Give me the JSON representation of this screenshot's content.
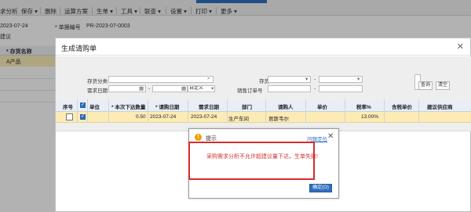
{
  "toolbar": {
    "items": [
      {
        "label": "求分析"
      },
      {
        "label": "保存 ▾"
      },
      {
        "label": "删除"
      },
      {
        "label": "运算方案"
      },
      {
        "label": "生单 ▾"
      },
      {
        "label": "工具 ▾"
      },
      {
        "label": "联查 ▾"
      },
      {
        "label": "设置 ▾"
      },
      {
        "label": "打印 ▾"
      },
      {
        "label": "更多 ▾"
      }
    ]
  },
  "background": {
    "date_value": "2023-07-24",
    "doc_no_label": "* 单据编号",
    "doc_no_value": "PR-2023-07-0003",
    "suggest_label": "建议",
    "grid_header": "* 存货名称",
    "grid_row": "A产品"
  },
  "dialog": {
    "title": "生成请购单",
    "close_glyph": "✕",
    "filters": {
      "category_label": "存货分类",
      "category_value": "",
      "demand_date_label": "需求日期",
      "date_from": "",
      "date_to": "",
      "date_mode": "自定义",
      "inventory_label": "存货",
      "inventory_from": "",
      "inventory_to": "",
      "sales_order_label": "销售订单号",
      "sales_order_from": "",
      "sales_order_to": "",
      "dash": "-"
    },
    "buttons": {
      "query": "查询",
      "clear": "清空"
    },
    "grid": {
      "headers": [
        "序号",
        "✓",
        "单位",
        "* 本次下达数量",
        "* 请购日期",
        "需求日期",
        "部门",
        "请购人",
        "单价",
        "税率%",
        "含税单价",
        "建议供应商"
      ],
      "row": {
        "seq": "",
        "qty": "0.50",
        "request_date": "2023-07-24",
        "demand_date": "2023-07-24",
        "department": "生产车间",
        "requester": "贾斯韦尔",
        "tax_rate": "13.00%"
      }
    }
  },
  "alert": {
    "title": "提示",
    "link": "问题定位",
    "close_glyph": "✕",
    "message": "采购需求分析不允许超建议量下达，生单失败!",
    "ok_label": "确定(O)",
    "icon": "warning-icon"
  },
  "colors": {
    "accent": "#2f6fbf",
    "row_highlight": "#fcebb4",
    "error_text": "#d03030",
    "annotation_box": "#d92b2b"
  }
}
